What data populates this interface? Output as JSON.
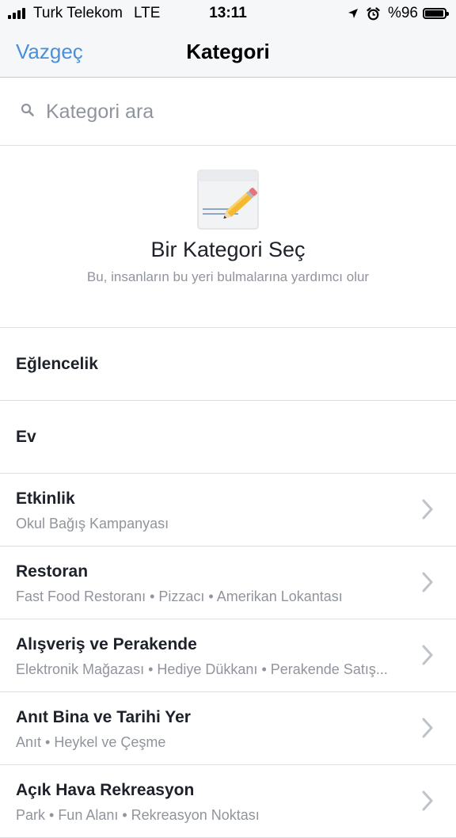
{
  "status_bar": {
    "carrier": "Turk Telekom",
    "network": "LTE",
    "time": "13:11",
    "battery_text": "%96",
    "battery_level": 0.96,
    "icons": [
      "signal-icon",
      "location-arrow-icon",
      "alarm-clock-icon",
      "battery-icon"
    ]
  },
  "nav": {
    "cancel_label": "Vazgeç",
    "title": "Kategori",
    "accent_color": "#4a90d9"
  },
  "search": {
    "placeholder": "Kategori ara",
    "value": "",
    "icon": "search-icon"
  },
  "header": {
    "icon": "pencil-note-icon",
    "title": "Bir Kategori Seç",
    "subtitle": "Bu, insanların bu yeri bulmalarına yardımcı olur"
  },
  "categories": [
    {
      "title": "Eğlencelik"
    },
    {
      "title": "Ev"
    },
    {
      "title": "Etkinlik",
      "subtitle": "Okul Bağış Kampanyası"
    },
    {
      "title": "Restoran",
      "subtitle": "Fast Food Restoranı • Pizzacı • Amerikan Lokantası"
    },
    {
      "title": "Alışveriş ve Perakende",
      "subtitle": "Elektronik Mağazası • Hediye Dükkanı • Perakende Satış..."
    },
    {
      "title": "Anıt Bina ve Tarihi Yer",
      "subtitle": "Anıt • Heykel ve Çeşme"
    },
    {
      "title": "Açık Hava Rekreasyon",
      "subtitle": "Park • Fun Alanı • Rekreasyon Noktası"
    }
  ]
}
